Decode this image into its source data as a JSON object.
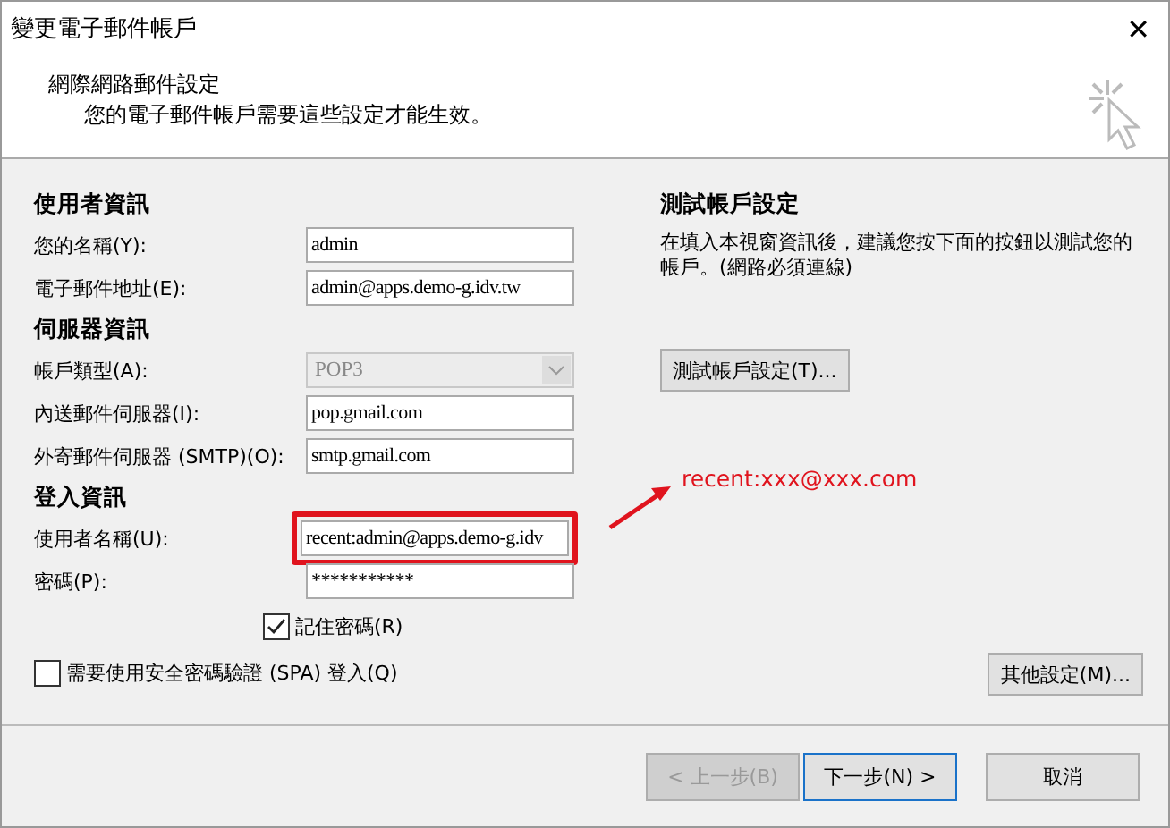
{
  "window": {
    "title": "變更電子郵件帳戶",
    "close": "✕"
  },
  "header": {
    "title": "網際網路郵件設定",
    "subtitle": "您的電子郵件帳戶需要這些設定才能生效。"
  },
  "left": [
    {
      "kind": "heading",
      "text": "使用者資訊"
    },
    {
      "kind": "text",
      "label": "您的名稱(Y):",
      "value": "admin",
      "highlighted": false
    },
    {
      "kind": "text",
      "label": "電子郵件地址(E):",
      "value": "admin@apps.demo-g.idv.tw",
      "highlighted": false
    },
    {
      "kind": "heading",
      "text": "伺服器資訊"
    },
    {
      "kind": "select",
      "label": "帳戶類型(A):",
      "value": "POP3",
      "disabled": true
    },
    {
      "kind": "text",
      "label": "內送郵件伺服器(I):",
      "value": "pop.gmail.com",
      "highlighted": false
    },
    {
      "kind": "text",
      "label": "外寄郵件伺服器 (SMTP)(O):",
      "value": "smtp.gmail.com",
      "highlighted": false
    },
    {
      "kind": "heading",
      "text": "登入資訊"
    },
    {
      "kind": "text",
      "label": "使用者名稱(U):",
      "value": "recent:admin@apps.demo-g.idv",
      "highlighted": true
    },
    {
      "kind": "text",
      "label": "密碼(P):",
      "value": "***********",
      "highlighted": false
    },
    {
      "kind": "checkbox",
      "label": "記住密碼(R)",
      "checked": true,
      "indent": true
    },
    {
      "kind": "checkbox",
      "label": "需要使用安全密碼驗證 (SPA) 登入(Q)",
      "checked": false,
      "indent": false
    }
  ],
  "right": {
    "title": "測試帳戶設定",
    "text": "在填入本視窗資訊後，建議您按下面的按鈕以測試您的帳戶。(網路必須連線)",
    "test_button": "測試帳戶設定(T)...",
    "more_button": "其他設定(M)..."
  },
  "annotation": {
    "text": "recent:xxx@xxx.com"
  },
  "footer": [
    {
      "label": "< 上一步(B)",
      "disabled": true,
      "default": false
    },
    {
      "label": "下一步(N) >",
      "disabled": false,
      "default": true
    },
    {
      "label": "取消",
      "disabled": false,
      "default": false
    }
  ]
}
